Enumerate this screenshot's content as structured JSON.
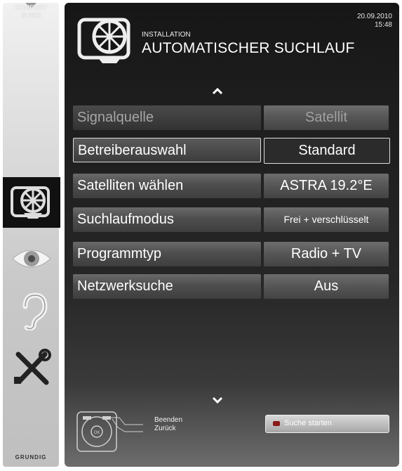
{
  "sidebar": {
    "comfort_guide_line1": "COMFORT",
    "comfort_guide_line2": "GUIDE",
    "brand": "GRUNDIG"
  },
  "header": {
    "date": "20.09.2010",
    "time": "15:48",
    "section": "INSTALLATION",
    "title": "AUTOMATISCHER SUCHLAUF"
  },
  "menu": [
    {
      "label": "Signalquelle",
      "value": "Satellit",
      "state": "disabled"
    },
    {
      "label": "Betreiberauswahl",
      "value": "Standard",
      "state": "selected"
    },
    {
      "label": "Satelliten wählen",
      "value": "ASTRA 19.2°E",
      "state": "normal"
    },
    {
      "label": "Suchlaufmodus",
      "value": "Frei + verschlüsselt",
      "state": "normal"
    },
    {
      "label": "Programmtyp",
      "value": "Radio + TV",
      "state": "normal"
    },
    {
      "label": "Netzwerksuche",
      "value": "Aus",
      "state": "normal"
    }
  ],
  "footer": {
    "remote_ok": "OK",
    "exit_label": "Beenden",
    "back_label": "Zurück",
    "start_button_label": "Suche starten",
    "start_button_color": "#8a1a1a"
  },
  "icons": {
    "header": "satellite-dish-icon",
    "sidebar": [
      "satellite-dish-icon",
      "eye-icon",
      "ear-icon",
      "tools-icon"
    ]
  }
}
